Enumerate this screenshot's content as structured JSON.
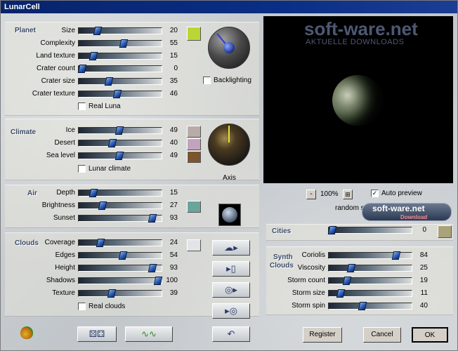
{
  "window": {
    "title": "LunarCell"
  },
  "sections": {
    "planet": {
      "title": "Planet",
      "sliders": [
        {
          "label": "Size",
          "value": 20
        },
        {
          "label": "Complexity",
          "value": 55
        },
        {
          "label": "Land texture",
          "value": 15
        },
        {
          "label": "Crater count",
          "value": 0
        },
        {
          "label": "Crater size",
          "value": 35
        },
        {
          "label": "Crater texture",
          "value": 46
        }
      ],
      "checkbox": {
        "label": "Real Luna",
        "checked": false
      },
      "backlighting": {
        "label": "Backlighting",
        "checked": false
      },
      "swatch_color": "#b9d635"
    },
    "climate": {
      "title": "Climate",
      "sliders": [
        {
          "label": "Ice",
          "value": 49
        },
        {
          "label": "Desert",
          "value": 40
        },
        {
          "label": "Sea level",
          "value": 49
        }
      ],
      "checkbox": {
        "label": "Lunar climate",
        "checked": false
      },
      "axis_label": "Axis",
      "swatch_colors": [
        "#b9aca8",
        "#c2a3bd",
        "#7a5530"
      ]
    },
    "air": {
      "title": "Air",
      "sliders": [
        {
          "label": "Depth",
          "value": 15
        },
        {
          "label": "Brightness",
          "value": 27
        },
        {
          "label": "Sunset",
          "value": 93
        }
      ],
      "swatch_color": "#6aa59a"
    },
    "clouds": {
      "title": "Clouds",
      "sliders": [
        {
          "label": "Coverage",
          "value": 24
        },
        {
          "label": "Edges",
          "value": 54
        },
        {
          "label": "Height",
          "value": 93
        },
        {
          "label": "Shadows",
          "value": 100
        },
        {
          "label": "Texture",
          "value": 39
        }
      ],
      "checkbox": {
        "label": "Real clouds",
        "checked": false
      },
      "swatch_color": "#e2e4e8"
    },
    "cities": {
      "title": "Cities",
      "value": 0,
      "swatch_color": "#a9a27a"
    },
    "synth_clouds": {
      "title_line1": "Synth",
      "title_line2": "Clouds",
      "sliders": [
        {
          "label": "Coriolis",
          "value": 84
        },
        {
          "label": "Viscosity",
          "value": 25
        },
        {
          "label": "Storm count",
          "value": 19
        },
        {
          "label": "Storm size",
          "value": 11
        },
        {
          "label": "Storm spin",
          "value": 40
        }
      ]
    }
  },
  "preview": {
    "watermark": "soft-ware.net",
    "watermark_sub": "AKTUELLE DOWNLOADS",
    "zoom_minus": "-",
    "zoom_level": "100%",
    "auto_preview": {
      "label": "Auto preview",
      "checked": true
    },
    "random_settings": "random settings",
    "badge_text": "soft-ware.net",
    "badge_sub": "Download"
  },
  "buttons": {
    "register": "Register",
    "cancel": "Cancel",
    "ok": "OK"
  },
  "icons": {
    "app": "acorn-icon",
    "dice": "dice-icon",
    "wave": "wave-icon",
    "cloud": "cloud-arrow-icon",
    "file": "file-arrow-icon",
    "disc_in": "disc-arrow-icon",
    "disc_out": "arrow-disc-icon",
    "undo": "undo-icon"
  }
}
